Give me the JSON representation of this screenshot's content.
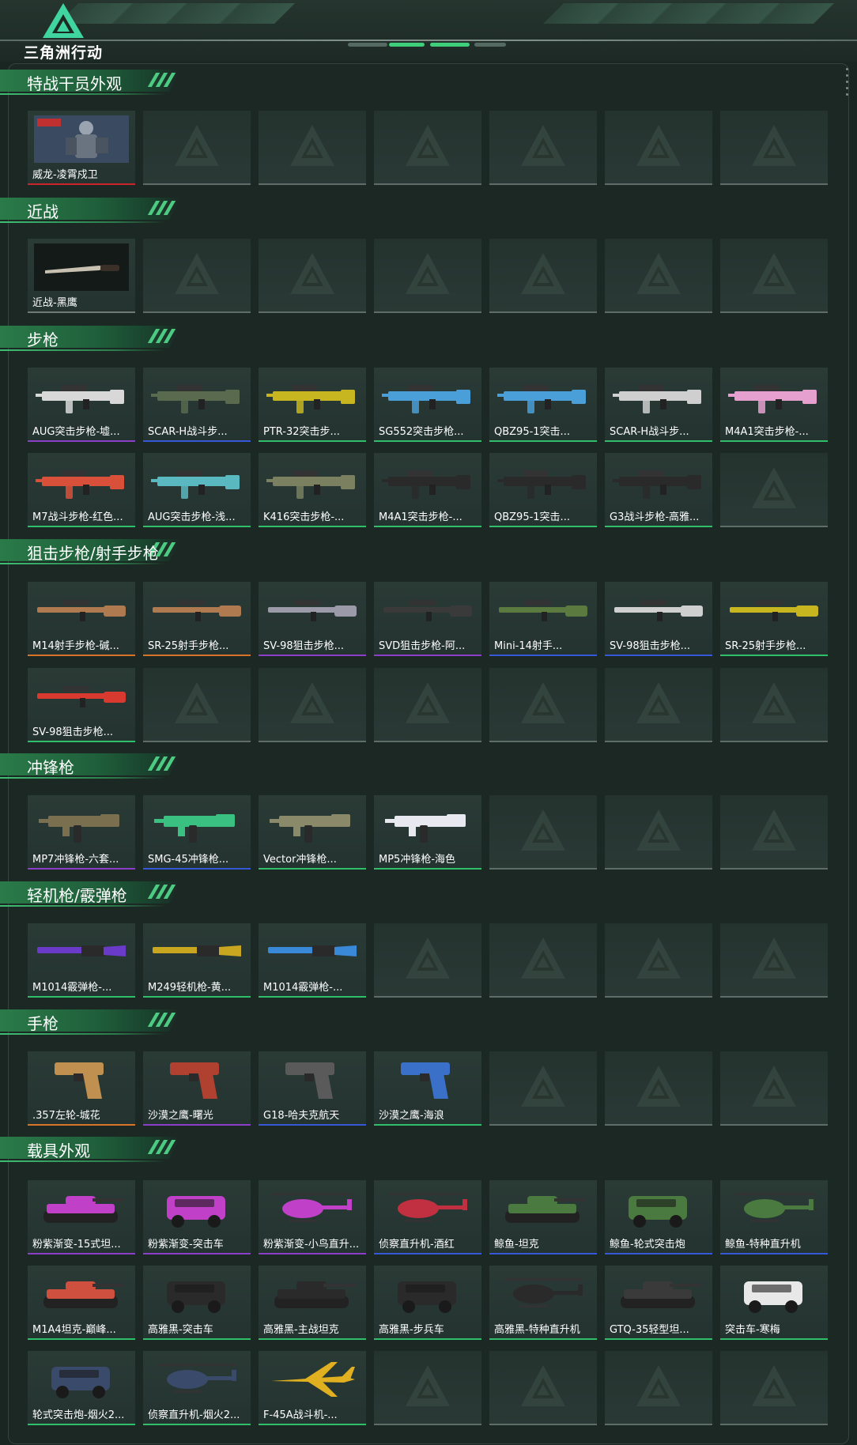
{
  "header": {
    "logo_text": "三角洲行动"
  },
  "sections": [
    {
      "title": "特战干员外观",
      "items": [
        {
          "label": "威龙-凌霄戍卫",
          "color": "#c9252a",
          "kind": "operator"
        }
      ]
    },
    {
      "title": "近战",
      "items": [
        {
          "label": "近战-黑鹰",
          "color": "#6e7a75",
          "kind": "knife"
        }
      ]
    },
    {
      "title": "步枪",
      "items": [
        {
          "label": "AUG突击步枪-墟...",
          "color": "#8b3fc8",
          "kind": "rifle",
          "tint": "#d8d8d8"
        },
        {
          "label": "SCAR-H战斗步...",
          "color": "#3458d6",
          "kind": "rifle",
          "tint": "#5a6a4e"
        },
        {
          "label": "PTR-32突击步...",
          "color": "#2fbf6a",
          "kind": "rifle",
          "tint": "#c8b620"
        },
        {
          "label": "SG552突击步枪...",
          "color": "#2fbf6a",
          "kind": "rifle",
          "tint": "#4a9fd8"
        },
        {
          "label": "QBZ95-1突击...",
          "color": "#2fbf6a",
          "kind": "rifle",
          "tint": "#4a9fd8"
        },
        {
          "label": "SCAR-H战斗步...",
          "color": "#2fbf6a",
          "kind": "rifle",
          "tint": "#cfcfcf"
        },
        {
          "label": "M4A1突击步枪-...",
          "color": "#2fbf6a",
          "kind": "rifle",
          "tint": "#e6a0d0"
        },
        {
          "label": "M7战斗步枪-红色...",
          "color": "#2fbf6a",
          "kind": "rifle",
          "tint": "#d8503a"
        },
        {
          "label": "AUG突击步枪-浅...",
          "color": "#2fbf6a",
          "kind": "rifle",
          "tint": "#5ab8c0"
        },
        {
          "label": "K416突击步枪-...",
          "color": "#2fbf6a",
          "kind": "rifle",
          "tint": "#7a8060"
        },
        {
          "label": "M4A1突击步枪-...",
          "color": "#2fbf6a",
          "kind": "rifle",
          "tint": "#2a2a2a"
        },
        {
          "label": "QBZ95-1突击...",
          "color": "#2fbf6a",
          "kind": "rifle",
          "tint": "#2a2a2a"
        },
        {
          "label": "G3战斗步枪-高雅...",
          "color": "#2fbf6a",
          "kind": "rifle",
          "tint": "#2a2a2a"
        }
      ]
    },
    {
      "title": "狙击步枪/射手步枪",
      "items": [
        {
          "label": "M14射手步枪-碱...",
          "color": "#d8742a",
          "kind": "sniper",
          "tint": "#b07a50"
        },
        {
          "label": "SR-25射手步枪...",
          "color": "#d8742a",
          "kind": "sniper",
          "tint": "#b07a50"
        },
        {
          "label": "SV-98狙击步枪...",
          "color": "#8b3fc8",
          "kind": "sniper",
          "tint": "#9a9aa8"
        },
        {
          "label": "SVD狙击步枪-阿...",
          "color": "#8b3fc8",
          "kind": "sniper",
          "tint": "#3a3a3a"
        },
        {
          "label": "Mini-14射手...",
          "color": "#3458d6",
          "kind": "sniper",
          "tint": "#5a7a40"
        },
        {
          "label": "SV-98狙击步枪...",
          "color": "#3458d6",
          "kind": "sniper",
          "tint": "#cfcfcf"
        },
        {
          "label": "SR-25射手步枪...",
          "color": "#2fbf6a",
          "kind": "sniper",
          "tint": "#c8b620"
        },
        {
          "label": "SV-98狙击步枪...",
          "color": "#2fbf6a",
          "kind": "sniper",
          "tint": "#d83a30"
        }
      ]
    },
    {
      "title": "冲锋枪",
      "items": [
        {
          "label": "MP7冲锋枪-六套...",
          "color": "#8b3fc8",
          "kind": "smg",
          "tint": "#7a7050"
        },
        {
          "label": "SMG-45冲锋枪...",
          "color": "#3458d6",
          "kind": "smg",
          "tint": "#3ac080"
        },
        {
          "label": "Vector冲锋枪...",
          "color": "#2fbf6a",
          "kind": "smg",
          "tint": "#8a8a6a"
        },
        {
          "label": "MP5冲锋枪-海色",
          "color": "#2fbf6a",
          "kind": "smg",
          "tint": "#e8e8f0"
        }
      ]
    },
    {
      "title": "轻机枪/霰弹枪",
      "items": [
        {
          "label": "M1014霰弹枪-...",
          "color": "#2fbf6a",
          "kind": "shotgun",
          "tint": "#6a3ac8"
        },
        {
          "label": "M249轻机枪-黄...",
          "color": "#2fbf6a",
          "kind": "shotgun",
          "tint": "#c8a620"
        },
        {
          "label": "M1014霰弹枪-...",
          "color": "#2fbf6a",
          "kind": "shotgun",
          "tint": "#3a88d8"
        }
      ]
    },
    {
      "title": "手枪",
      "items": [
        {
          "label": ".357左轮-城花",
          "color": "#d8742a",
          "kind": "pistol",
          "tint": "#c09050"
        },
        {
          "label": "沙漠之鹰-曙光",
          "color": "#8b3fc8",
          "kind": "pistol",
          "tint": "#b04030"
        },
        {
          "label": "G18-哈夫克航天",
          "color": "#3458d6",
          "kind": "pistol",
          "tint": "#5a5a5a"
        },
        {
          "label": "沙漠之鹰-海浪",
          "color": "#2fbf6a",
          "kind": "pistol",
          "tint": "#3a70c8"
        }
      ]
    },
    {
      "title": "载具外观",
      "items": [
        {
          "label": "粉紫渐变-15式坦...",
          "color": "#8b3fc8",
          "kind": "tank",
          "tint": "#c040c8"
        },
        {
          "label": "粉紫渐变-突击车",
          "color": "#8b3fc8",
          "kind": "car",
          "tint": "#c040c8"
        },
        {
          "label": "粉紫渐变-小鸟直升...",
          "color": "#8b3fc8",
          "kind": "heli",
          "tint": "#c040c8"
        },
        {
          "label": "侦察直升机-酒红",
          "color": "#3458d6",
          "kind": "heli",
          "tint": "#c03040"
        },
        {
          "label": "鲸鱼-坦克",
          "color": "#3458d6",
          "kind": "tank",
          "tint": "#4a7a40"
        },
        {
          "label": "鲸鱼-轮式突击炮",
          "color": "#3458d6",
          "kind": "car",
          "tint": "#4a7a40"
        },
        {
          "label": "鲸鱼-特种直升机",
          "color": "#3458d6",
          "kind": "heli",
          "tint": "#4a7a40"
        },
        {
          "label": "M1A4坦克-巅峰...",
          "color": "#2fbf6a",
          "kind": "tank",
          "tint": "#d05040"
        },
        {
          "label": "高雅黑-突击车",
          "color": "#2fbf6a",
          "kind": "car",
          "tint": "#2a2a2a"
        },
        {
          "label": "高雅黑-主战坦克",
          "color": "#2fbf6a",
          "kind": "tank",
          "tint": "#2a2a2a"
        },
        {
          "label": "高雅黑-步兵车",
          "color": "#2fbf6a",
          "kind": "car",
          "tint": "#2a2a2a"
        },
        {
          "label": "高雅黑-特种直升机",
          "color": "#2fbf6a",
          "kind": "heli",
          "tint": "#2a2a2a"
        },
        {
          "label": "GTQ-35轻型坦...",
          "color": "#2fbf6a",
          "kind": "tank",
          "tint": "#3a3a3a"
        },
        {
          "label": "突击车-寒梅",
          "color": "#2fbf6a",
          "kind": "car",
          "tint": "#e8e8e8"
        },
        {
          "label": "轮式突击炮-烟火2...",
          "color": "#2fbf6a",
          "kind": "car",
          "tint": "#3a4a6a"
        },
        {
          "label": "侦察直升机-烟火2...",
          "color": "#2fbf6a",
          "kind": "heli",
          "tint": "#3a4a6a"
        },
        {
          "label": "F-45A战斗机-...",
          "color": "#2fbf6a",
          "kind": "jet",
          "tint": "#e0b020"
        }
      ]
    }
  ],
  "colors": {
    "accent": "#2fbf6a",
    "purple": "#8b3fc8",
    "blue": "#3458d6",
    "orange": "#d8742a",
    "red": "#c9252a"
  }
}
